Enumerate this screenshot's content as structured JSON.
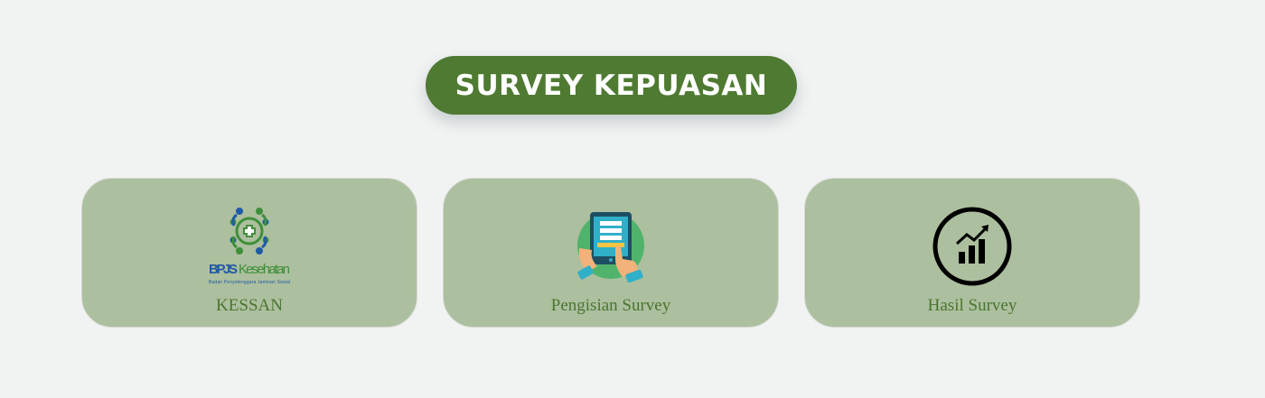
{
  "title": "SURVEY KEPUASAN",
  "colors": {
    "background": "#f1f2f2",
    "title_pill": "#4f7a32",
    "card": "#acbf9e",
    "label": "#4b7530"
  },
  "cards": [
    {
      "label": "KESSAN",
      "icon": "bpjs-kesehatan-logo",
      "logo_text": "BPJS Kesehatan",
      "logo_subtext": "Badan Penyelenggara Jaminan Sosial"
    },
    {
      "label": "Pengisian Survey",
      "icon": "tablet-survey-icon"
    },
    {
      "label": "Hasil Survey",
      "icon": "bar-chart-trend-icon"
    }
  ]
}
